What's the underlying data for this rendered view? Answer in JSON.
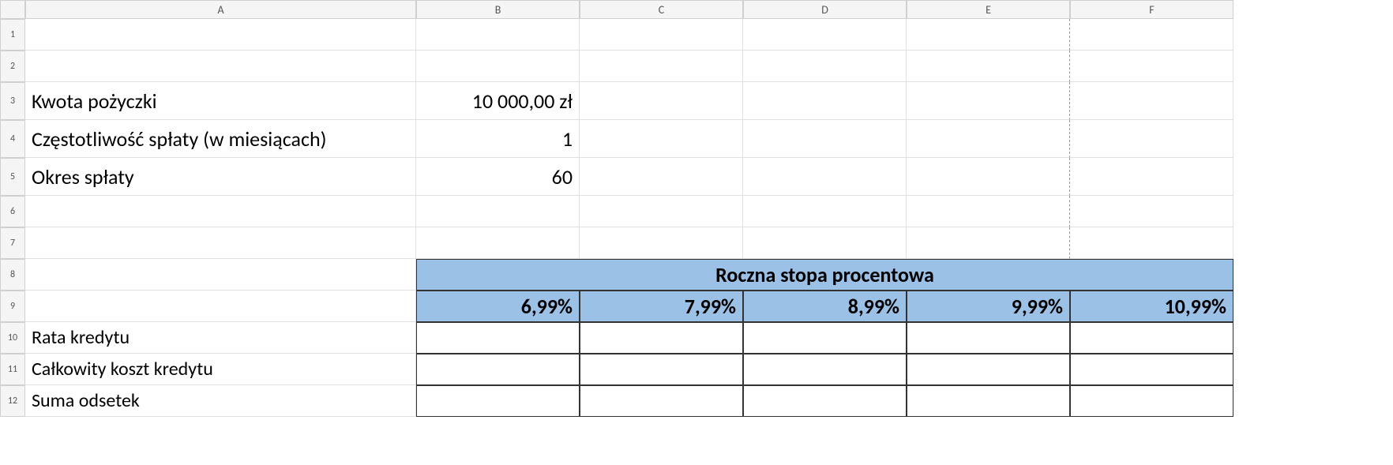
{
  "columns": [
    "A",
    "B",
    "C",
    "D",
    "E",
    "F"
  ],
  "rows": [
    "1",
    "2",
    "3",
    "4",
    "5",
    "6",
    "7",
    "8",
    "9",
    "10",
    "11",
    "12"
  ],
  "labels": {
    "loan_amount": "Kwota pożyczki",
    "payment_frequency": "Częstotliwość spłaty (w miesiącach)",
    "repayment_period": "Okres spłaty",
    "annual_rate_header": "Roczna stopa procentowa",
    "loan_installment": "Rata kredytu",
    "total_cost": "Całkowity koszt kredytu",
    "interest_sum": "Suma odsetek"
  },
  "values": {
    "loan_amount": "10 000,00 zł",
    "payment_frequency": "1",
    "repayment_period": "60"
  },
  "rates": [
    "6,99%",
    "7,99%",
    "8,99%",
    "9,99%",
    "10,99%"
  ]
}
